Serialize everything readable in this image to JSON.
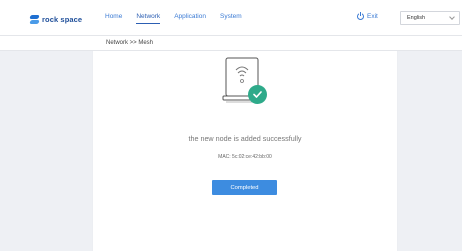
{
  "header": {
    "logo_text": "rock space",
    "nav": [
      {
        "label": "Home",
        "active": false
      },
      {
        "label": "Network",
        "active": true
      },
      {
        "label": "Application",
        "active": false
      },
      {
        "label": "System",
        "active": false
      }
    ],
    "exit_label": "Exit",
    "language": {
      "selected": "English"
    }
  },
  "breadcrumb": "Network >> Mesh",
  "result": {
    "icon": "router-with-check-icon",
    "title": "the new node is added successfully",
    "mac": "MAC: 5c:02:ce:42:bb:00",
    "button_label": "Completed"
  },
  "colors": {
    "accent": "#3d8ce0",
    "success": "#2eaa8a",
    "nav_text": "#3b7bd4",
    "background": "#eef0f4"
  }
}
